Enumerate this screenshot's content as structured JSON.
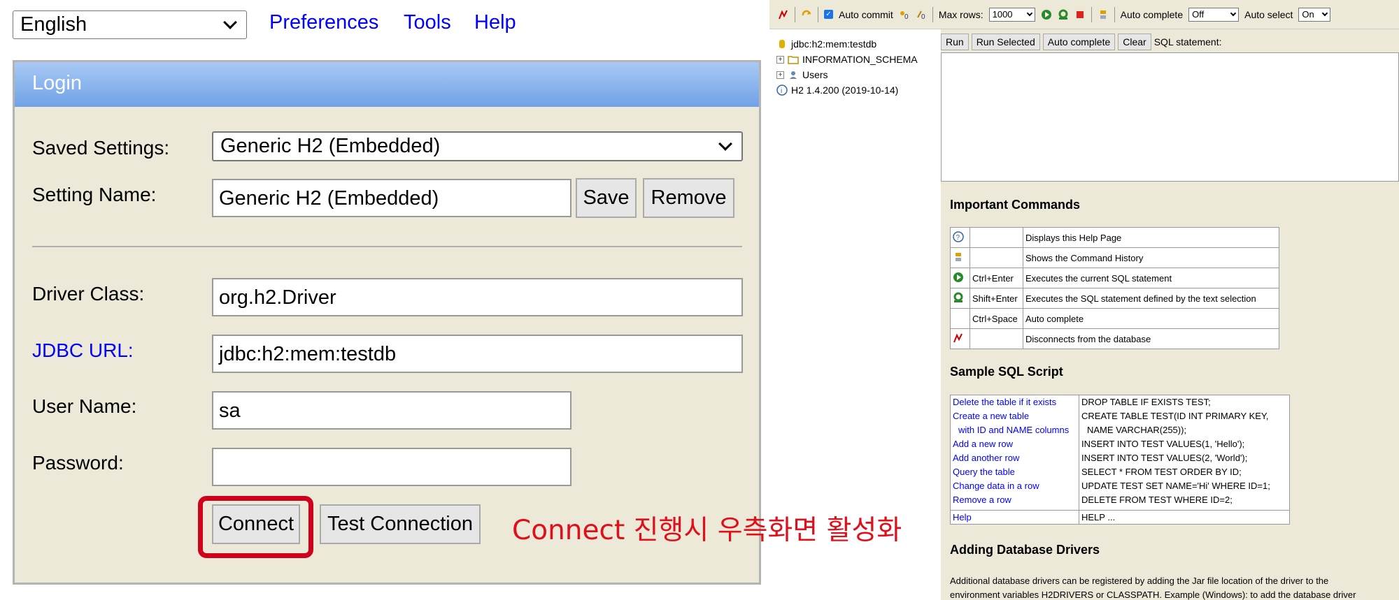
{
  "login_page": {
    "language": "English",
    "nav": [
      "Preferences",
      "Tools",
      "Help"
    ],
    "title": "Login",
    "saved_settings_label": "Saved Settings:",
    "saved_settings_value": "Generic H2 (Embedded)",
    "setting_name_label": "Setting Name:",
    "setting_name_value": "Generic H2 (Embedded)",
    "save_label": "Save",
    "remove_label": "Remove",
    "driver_class_label": "Driver Class:",
    "driver_class_value": "org.h2.Driver",
    "jdbc_url_label": "JDBC URL:",
    "jdbc_url_value": "jdbc:h2:mem:testdb",
    "user_name_label": "User Name:",
    "user_name_value": "sa",
    "password_label": "Password:",
    "password_value": "",
    "connect_label": "Connect",
    "test_connection_label": "Test Connection",
    "annotation": "Connect 진행시 우측화면 활성화",
    "annotation_color": "#e0101a"
  },
  "console": {
    "toolbar": {
      "auto_commit_label": "Auto commit",
      "max_rows_label": "Max rows:",
      "max_rows_value": "1000",
      "auto_complete_label": "Auto complete",
      "auto_complete_value": "Off",
      "auto_select_label": "Auto select",
      "auto_select_value": "On"
    },
    "tree": {
      "db": "jdbc:h2:mem:testdb",
      "schema": "INFORMATION_SCHEMA",
      "users": "Users",
      "version": "H2 1.4.200 (2019-10-14)"
    },
    "sql_buttons": [
      "Run",
      "Run Selected",
      "Auto complete",
      "Clear"
    ],
    "sql_statement_label": "SQL statement:",
    "important_commands_title": "Important Commands",
    "commands": [
      {
        "key": "",
        "desc": "Displays this Help Page"
      },
      {
        "key": "",
        "desc": "Shows the Command History"
      },
      {
        "key": "Ctrl+Enter",
        "desc": "Executes the current SQL statement"
      },
      {
        "key": "Shift+Enter",
        "desc": "Executes the SQL statement defined by the text selection"
      },
      {
        "key": "Ctrl+Space",
        "desc": "Auto complete"
      },
      {
        "key": "",
        "desc": "Disconnects from the database"
      }
    ],
    "sample_title": "Sample SQL Script",
    "sample_left": [
      "Delete the table if it exists",
      "Create a new table",
      "  with ID and NAME columns",
      "Add a new row",
      "Add another row",
      "Query the table",
      "Change data in a row",
      "Remove a row"
    ],
    "sample_right": [
      "DROP TABLE IF EXISTS TEST;",
      "CREATE TABLE TEST(ID INT PRIMARY KEY,",
      "   NAME VARCHAR(255));",
      "INSERT INTO TEST VALUES(1, 'Hello');",
      "INSERT INTO TEST VALUES(2, 'World');",
      "SELECT * FROM TEST ORDER BY ID;",
      "UPDATE TEST SET NAME='Hi' WHERE ID=1;",
      "DELETE FROM TEST WHERE ID=2;"
    ],
    "help_left": "Help",
    "help_right": "HELP ...",
    "drivers_title": "Adding Database Drivers",
    "drivers_text_1": "Additional database drivers can be registered by adding the Jar file location of the driver to the",
    "drivers_text_2": "environment variables H2DRIVERS or CLASSPATH. Example (Windows): to add the database driver"
  }
}
